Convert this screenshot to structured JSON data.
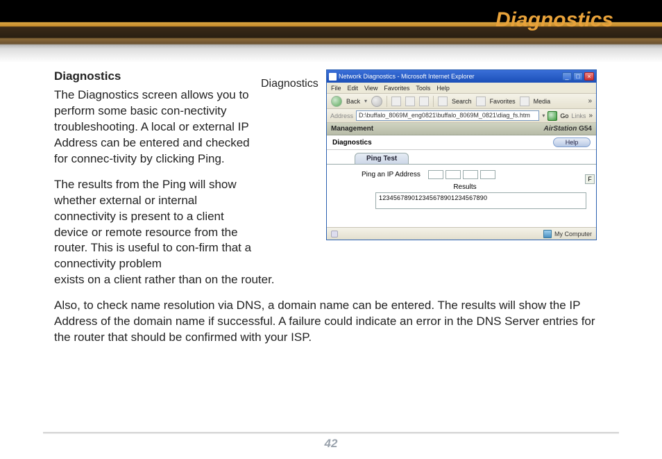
{
  "header": {
    "title": "Diagnostics"
  },
  "section": {
    "heading": "Diagnostics",
    "p1": "The Diagnostics screen allows you to perform some basic con-nectivity troubleshooting. A local or external IP Address can be entered and checked for connec-tivity by clicking Ping.",
    "p2a": "The results from the Ping will show whether external or internal connectivity is present to a client device or remote resource from the router. This is useful to con-firm that a connectivity problem",
    "p2b": "exists on a client rather than on the router.",
    "p3": "Also, to check name resolution via DNS, a domain name can be entered. The results will show the IP Address of the domain name if successful. A failure could indicate an error in the DNS Server entries for the router that should be confirmed with your ISP."
  },
  "figure": {
    "caption": "Diagnostics",
    "window_title": "Network Diagnostics - Microsoft Internet Explorer",
    "menu": {
      "file": "File",
      "edit": "Edit",
      "view": "View",
      "favorites": "Favorites",
      "tools": "Tools",
      "help": "Help"
    },
    "toolbar": {
      "back": "Back",
      "search": "Search",
      "favorites": "Favorites",
      "media": "Media"
    },
    "address_label": "Address",
    "address_value": "D:\\buffalo_8069M_eng0821\\buffalo_8069M_0821\\diag_fs.htm",
    "go": "Go",
    "links": "Links",
    "tab_management": "Management",
    "brand": "AirStation",
    "brand_suffix": "G54",
    "diag_label": "Diagnostics",
    "help": "Help",
    "ping_tab": "Ping Test",
    "ping_label": "Ping an IP Address",
    "edge_btn": "F",
    "results_label": "Results",
    "results_value": "123456789012345678901234567890",
    "status_zone": "My Computer"
  },
  "footer": {
    "page": "42"
  }
}
